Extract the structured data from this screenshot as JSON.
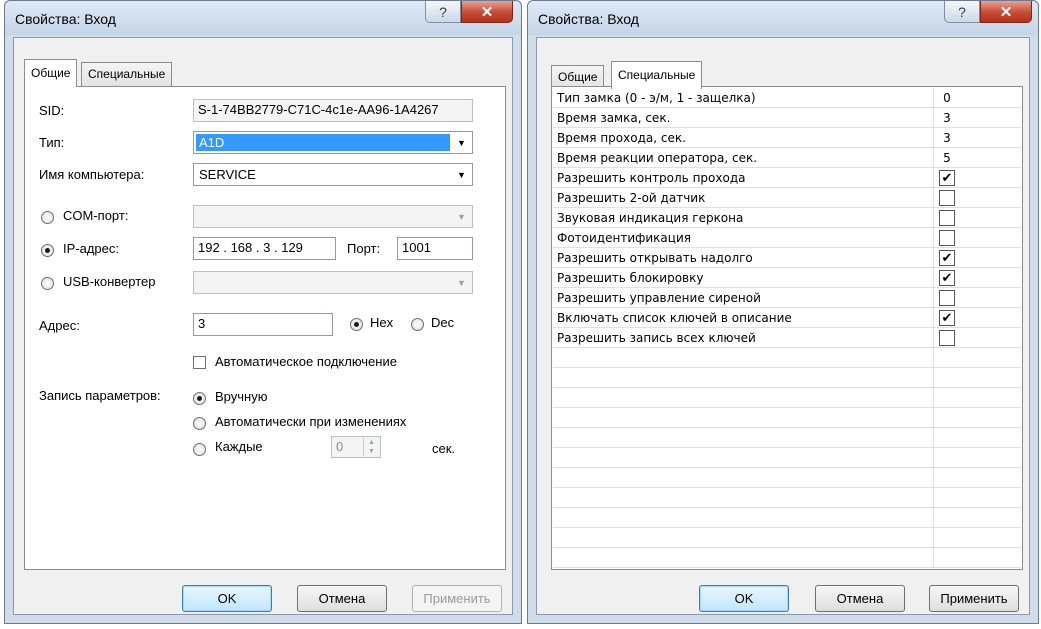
{
  "left": {
    "title": "Свойства: Вход",
    "tabs": [
      {
        "label": "Общие",
        "active": true
      },
      {
        "label": "Специальные",
        "active": false
      }
    ],
    "sid_label": "SID:",
    "sid_value": "S-1-74BB2779-C71C-4c1e-AA96-1A4267",
    "type_label": "Тип:",
    "type_value": "A1D",
    "computer_label": "Имя компьютера:",
    "computer_value": "SERVICE",
    "com_label": "COM-порт:",
    "ip_label": "IP-адрес:",
    "ip_octets": [
      "192",
      "168",
      "3",
      "129"
    ],
    "port_label": "Порт:",
    "port_value": "1001",
    "usb_label": "USB-конвертер",
    "address_label": "Адрес:",
    "address_value": "3",
    "hex_label": "Hex",
    "dec_label": "Dec",
    "auto_connect_label": "Автоматическое подключение",
    "write_params_label": "Запись параметров:",
    "manual_label": "Вручную",
    "auto_changes_label": "Автоматически при изменениях",
    "every_label": "Каждые",
    "every_value": "0",
    "sec_label": "сек.",
    "buttons": {
      "ok": "OK",
      "cancel": "Отмена",
      "apply": "Применить"
    }
  },
  "right": {
    "title": "Свойства: Вход",
    "tabs": [
      {
        "label": "Общие",
        "active": false
      },
      {
        "label": "Специальные",
        "active": true
      }
    ],
    "rows": [
      {
        "name": "Тип замка (0 - э/м, 1 - защелка)",
        "kind": "value",
        "value": "0"
      },
      {
        "name": "Время замка, сек.",
        "kind": "value",
        "value": "3"
      },
      {
        "name": "Время прохода, сек.",
        "kind": "value",
        "value": "3"
      },
      {
        "name": "Время реакции оператора, сек.",
        "kind": "value",
        "value": "5"
      },
      {
        "name": "Разрешить контроль прохода",
        "kind": "check",
        "checked": true
      },
      {
        "name": "Разрешить 2-ой датчик",
        "kind": "check",
        "checked": false
      },
      {
        "name": "Звуковая индикация геркона",
        "kind": "check",
        "checked": false
      },
      {
        "name": "Фотоидентификация",
        "kind": "check",
        "checked": false
      },
      {
        "name": "Разрешить открывать надолго",
        "kind": "check",
        "checked": true
      },
      {
        "name": "Разрешить блокировку",
        "kind": "check",
        "checked": true
      },
      {
        "name": "Разрешить управление сиреной",
        "kind": "check",
        "checked": false
      },
      {
        "name": "Включать список ключей в описание",
        "kind": "check",
        "checked": true
      },
      {
        "name": "Разрешить запись всех ключей",
        "kind": "check",
        "checked": false
      }
    ],
    "buttons": {
      "ok": "OK",
      "cancel": "Отмена",
      "apply": "Применить"
    }
  },
  "icons": {
    "help": "help-icon",
    "close": "close-icon",
    "check": "check-icon",
    "dropdown": "chevron-down-icon"
  },
  "colors": {
    "selection": "#3399ff",
    "close": "#c74a35",
    "titlebar": "#cfdcea"
  }
}
